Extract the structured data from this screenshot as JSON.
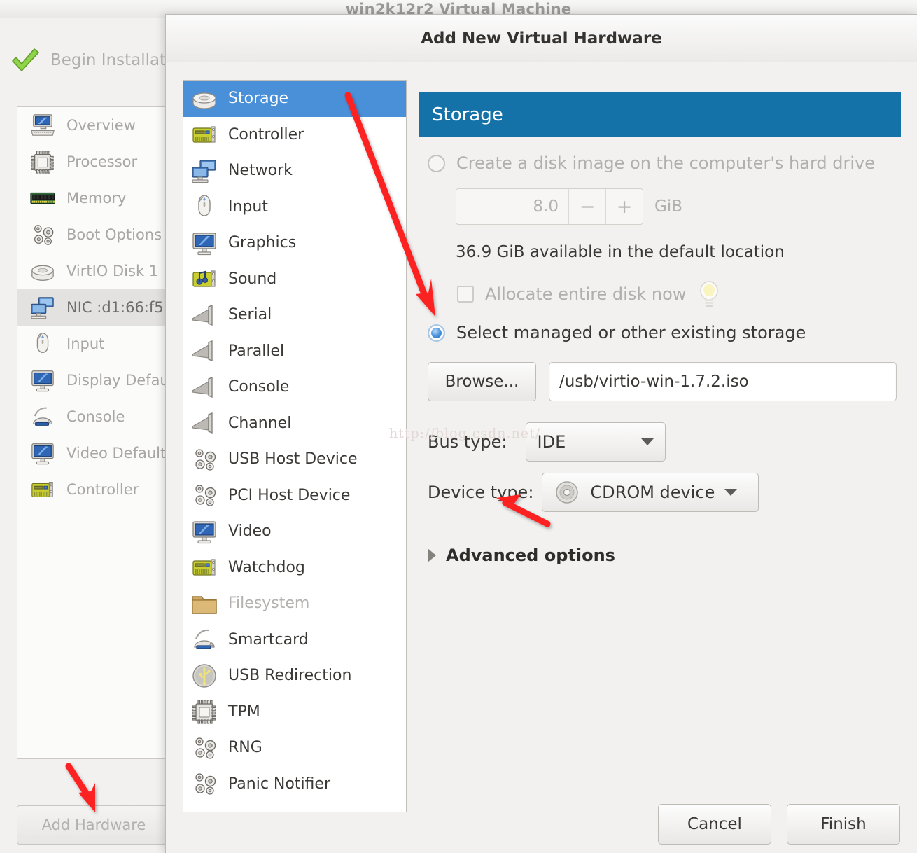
{
  "parent_window": {
    "title": "win2k12r2 Virtual Machine",
    "begin_install_label": "Begin Installation",
    "begin_install_icon": "green-check-icon",
    "add_hardware_label": "Add Hardware",
    "hardware_items": [
      {
        "label": "Overview",
        "icon": "computer-icon",
        "selected": false
      },
      {
        "label": "Processor",
        "icon": "cpu-icon",
        "selected": false
      },
      {
        "label": "Memory",
        "icon": "memory-icon",
        "selected": false
      },
      {
        "label": "Boot Options",
        "icon": "gears-icon",
        "selected": false
      },
      {
        "label": "VirtIO Disk 1",
        "icon": "harddisk-icon",
        "selected": false
      },
      {
        "label": "NIC :d1:66:f5",
        "icon": "network-icon",
        "selected": true
      },
      {
        "label": "Input",
        "icon": "mouse-icon",
        "selected": false
      },
      {
        "label": "Display Default",
        "icon": "monitor-icon",
        "selected": false
      },
      {
        "label": "Console",
        "icon": "smartcard-icon",
        "selected": false
      },
      {
        "label": "Video Default",
        "icon": "monitor-icon",
        "selected": false
      },
      {
        "label": "Controller",
        "icon": "pcicard-icon",
        "selected": false
      }
    ]
  },
  "dialog": {
    "title": "Add New Virtual Hardware",
    "hardware_types": [
      {
        "label": "Storage",
        "icon": "harddisk-icon",
        "selected": true,
        "disabled": false
      },
      {
        "label": "Controller",
        "icon": "pcicard-icon",
        "selected": false,
        "disabled": false
      },
      {
        "label": "Network",
        "icon": "network-icon",
        "selected": false,
        "disabled": false
      },
      {
        "label": "Input",
        "icon": "mouse-icon",
        "selected": false,
        "disabled": false
      },
      {
        "label": "Graphics",
        "icon": "monitor-icon",
        "selected": false,
        "disabled": false
      },
      {
        "label": "Sound",
        "icon": "soundcard-icon",
        "selected": false,
        "disabled": false
      },
      {
        "label": "Serial",
        "icon": "serial-port-icon",
        "selected": false,
        "disabled": false
      },
      {
        "label": "Parallel",
        "icon": "serial-port-icon",
        "selected": false,
        "disabled": false
      },
      {
        "label": "Console",
        "icon": "serial-port-icon",
        "selected": false,
        "disabled": false
      },
      {
        "label": "Channel",
        "icon": "serial-port-icon",
        "selected": false,
        "disabled": false
      },
      {
        "label": "USB Host Device",
        "icon": "gears-icon",
        "selected": false,
        "disabled": false
      },
      {
        "label": "PCI Host Device",
        "icon": "gears-icon",
        "selected": false,
        "disabled": false
      },
      {
        "label": "Video",
        "icon": "monitor-icon",
        "selected": false,
        "disabled": false
      },
      {
        "label": "Watchdog",
        "icon": "pcicard-icon",
        "selected": false,
        "disabled": false
      },
      {
        "label": "Filesystem",
        "icon": "folder-icon",
        "selected": false,
        "disabled": true
      },
      {
        "label": "Smartcard",
        "icon": "smartcard-icon",
        "selected": false,
        "disabled": false
      },
      {
        "label": "USB Redirection",
        "icon": "usb-icon",
        "selected": false,
        "disabled": false
      },
      {
        "label": "TPM",
        "icon": "cpu-icon",
        "selected": false,
        "disabled": false
      },
      {
        "label": "RNG",
        "icon": "gears-icon",
        "selected": false,
        "disabled": false
      },
      {
        "label": "Panic Notifier",
        "icon": "gears-icon",
        "selected": false,
        "disabled": false
      }
    ],
    "pane": {
      "header": "Storage",
      "create_disk_label": "Create a disk image on the computer's hard drive",
      "create_disk_selected": false,
      "disk_size_value": "8.0",
      "disk_size_unit": "GiB",
      "spin_minus": "−",
      "spin_plus": "+",
      "available_text": "36.9 GiB available in the default location",
      "allocate_label": "Allocate entire disk now",
      "allocate_checked": false,
      "allocate_hint_icon": "lightbulb-icon",
      "select_managed_label": "Select managed or other existing storage",
      "select_managed_selected": true,
      "browse_label": "Browse...",
      "path_value": "/usb/virtio-win-1.7.2.iso",
      "bus_type_label": "Bus type:",
      "bus_type_value": "IDE",
      "device_type_label": "Device type:",
      "device_type_value": "CDROM device",
      "device_type_icon": "cdrom-icon",
      "advanced_label": "Advanced options"
    },
    "footer": {
      "cancel_label": "Cancel",
      "finish_label": "Finish"
    }
  },
  "watermark": "http://blog.csdn.net/",
  "colors": {
    "pane_header_blue": "#1472a8",
    "selection_blue": "#4a90d9",
    "annotation_red": "#fc2020",
    "window_bg": "#f2f1f0"
  }
}
